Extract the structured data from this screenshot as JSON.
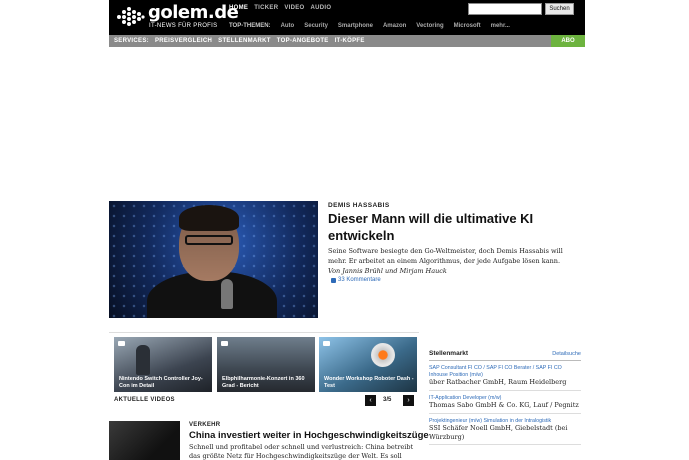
{
  "header": {
    "logo_text": "golem.de",
    "logo_subtitle": "IT-NEWS FÜR PROFIS",
    "nav": [
      "HOME",
      "TICKER",
      "VIDEO",
      "AUDIO"
    ],
    "topics_label": "TOP-THEMEN:",
    "topics": [
      "Auto",
      "Security",
      "Smartphone",
      "Amazon",
      "Vectoring",
      "Microsoft",
      "mehr..."
    ],
    "search_placeholder": "",
    "search_button": "Suchen"
  },
  "servicebar": {
    "items": [
      "SERVICES:",
      "PREISVERGLEICH",
      "STELLENMARKT",
      "TOP-ANGEBOTE",
      "IT-KÖPFE"
    ],
    "abo": "ABO"
  },
  "lead": {
    "kicker": "DEMIS HASSABIS",
    "title": "Dieser Mann will die ultimative KI entwickeln",
    "teaser": "Seine Software besiegte den Go-Weltmeister, doch Demis Hassabis will mehr. Er arbeitet an einem Algorithmus, der jede Aufgabe lösen kann.",
    "author": "Von Jannis Brühl und Mirjam Hauck",
    "comments": "33 Kommentare"
  },
  "videos": {
    "items": [
      {
        "caption": "Nintendo Switch Controller Joy-Con im Detail"
      },
      {
        "caption": "Elbphilharmonie-Konzert in 360 Grad - Bericht"
      },
      {
        "caption": "Wonder Workshop Roboter Dash - Test"
      }
    ],
    "label": "AKTUELLE VIDEOS",
    "page": "3/5"
  },
  "article2": {
    "kicker": "VERKEHR",
    "title": "China investiert weiter in Hochgeschwindigkeitszüge",
    "teaser": "Schnell und profitabel oder schnell und verlustreich: China betreibt das größte Netz für Hochgeschwindigkeitszüge der Welt. Es soll"
  },
  "stellenmarkt": {
    "title": "Stellenmarkt",
    "link": "Detailsuche",
    "jobs": [
      {
        "title": "SAP Consultant FI CO / SAP FI CO Berater / SAP FI CO Inhouse Position (m/w)",
        "company": "über Ratbacher GmbH, Raum Heidelberg"
      },
      {
        "title": "IT-Application Developer (m/w)",
        "company": "Thomas Sabo GmbH & Co. KG, Lauf / Pegnitz"
      },
      {
        "title": "Projektingenieur (m/w) Simulation in der Intralogistik",
        "company": "SSI Schäfer Noell GmbH, Giebelstadt (bei Würzburg)"
      }
    ]
  }
}
